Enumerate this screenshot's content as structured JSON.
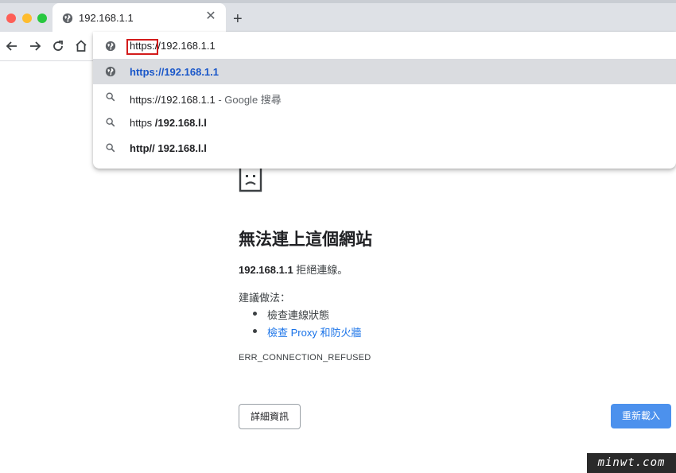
{
  "tab": {
    "title": "192.168.1.1",
    "favicon": "globe-icon",
    "close_glyph": "✕"
  },
  "new_tab_glyph": "+",
  "toolbar": {
    "back": "arrow-left-icon",
    "forward": "arrow-right-icon",
    "reload": "reload-icon",
    "home": "home-icon"
  },
  "omnibox": {
    "input_value": "https://192.168.1.1",
    "suggestions": [
      {
        "icon": "globe-icon",
        "text": "https://192.168.1.1",
        "selected": true
      },
      {
        "icon": "search-icon",
        "text": "https://192.168.1.1",
        "suffix": " - Google 搜尋"
      },
      {
        "icon": "search-icon",
        "prefix": "https ",
        "text": "/192.168.l.l"
      },
      {
        "icon": "search-icon",
        "text": "http// 192.168.l.l"
      }
    ]
  },
  "error": {
    "title": "無法連上這個網站",
    "host": "192.168.1.1",
    "desc_suffix": " 拒絕連線。",
    "try_title": "建議做法：",
    "try_items": [
      {
        "text": "檢查連線狀態",
        "link": false
      },
      {
        "text": "檢查 Proxy 和防火牆",
        "link": true
      }
    ],
    "code": "ERR_CONNECTION_REFUSED",
    "details_label": "詳細資訊",
    "reload_label": "重新載入"
  },
  "watermark": "minwt.com",
  "colors": {
    "accent": "#1a73e8",
    "link": "#1a57c9",
    "highlight_border": "#d31b1b",
    "tabbar": "#dee1e6"
  }
}
